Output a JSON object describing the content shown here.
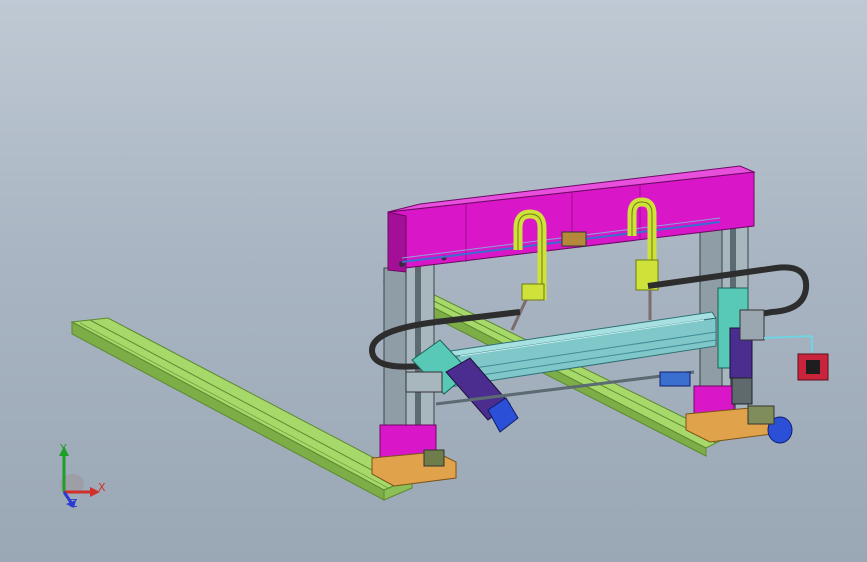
{
  "viewport": {
    "background_top": "#bfc9d4",
    "background_bottom": "#9aa7b5"
  },
  "triad": {
    "x_label": "X",
    "y_label": "Y",
    "z_label": "Z",
    "x_color": "#d0302a",
    "y_color": "#1f9e2a",
    "z_color": "#2a3bd0"
  },
  "model": {
    "colors": {
      "crossbeam": "#d916c8",
      "crossbeam_dark": "#a30f96",
      "rail": "#a7d86a",
      "rail_dark": "#7cad47",
      "rail_edge": "#5d8a2f",
      "column": "#8f9ea6",
      "column_dark": "#5c6a72",
      "carriage_beam": "#7fc7c8",
      "carriage_dark": "#3f8d96",
      "hanger": "#cfe23a",
      "cable_chain": "#2d2d2d",
      "foot_block": "#e0a24a",
      "tool_head": "#58c9b7",
      "motor": "#4a2d8f",
      "motor_blue": "#2c4fd8",
      "red_box": "#c9243b",
      "rod": "#3b6fcf"
    }
  }
}
